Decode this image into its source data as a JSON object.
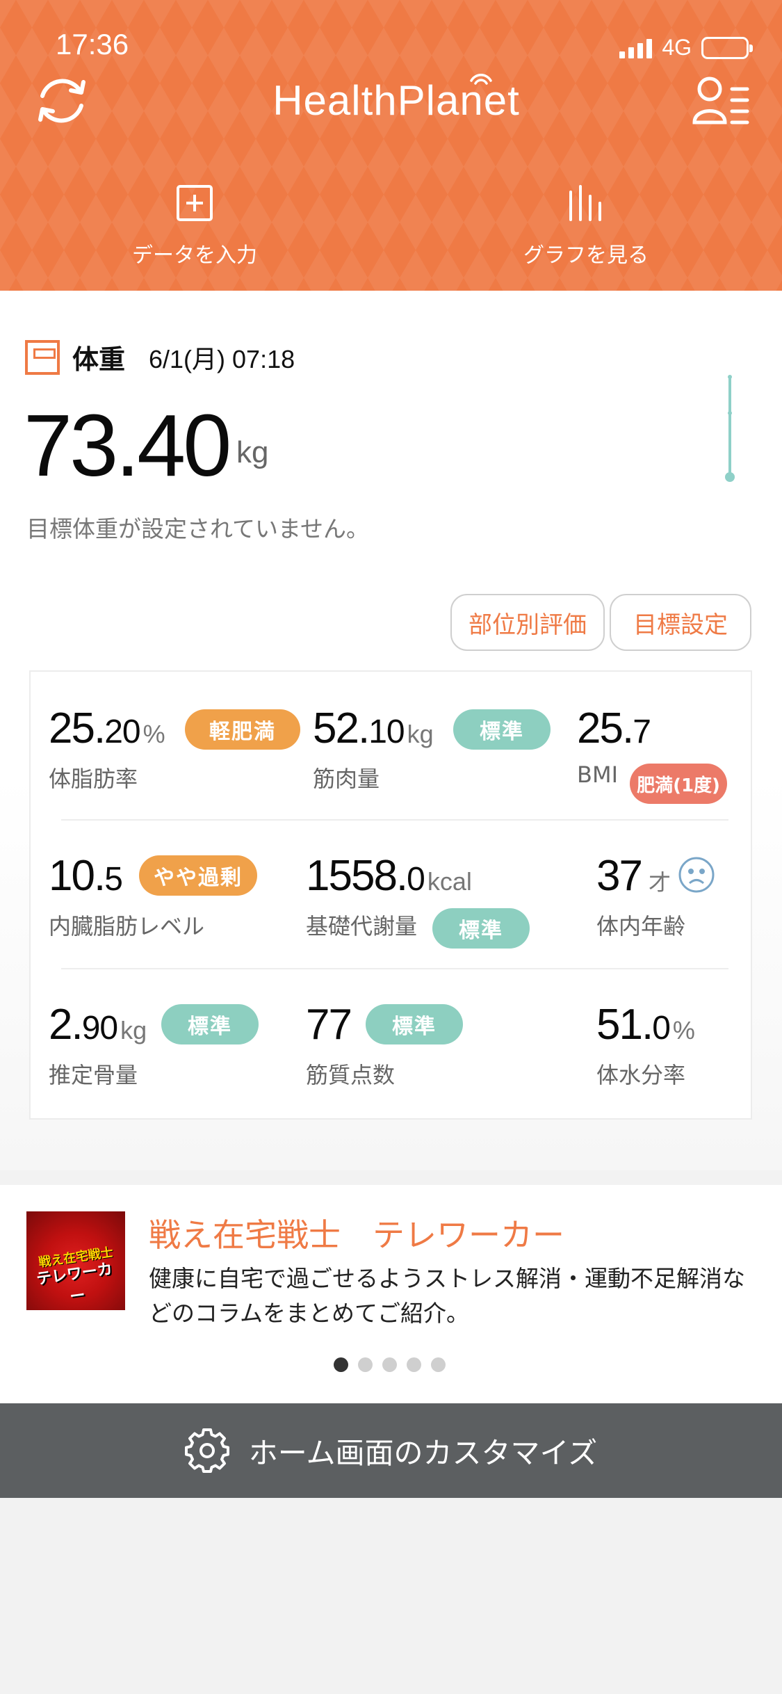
{
  "status_bar": {
    "time": "17:36",
    "network": "4G"
  },
  "header": {
    "logo": "HealthPlanet",
    "actions": [
      {
        "label": "データを入力",
        "icon": "plus-square-icon"
      },
      {
        "label": "グラフを見る",
        "icon": "bar-graph-icon"
      }
    ],
    "accent_color": "#ef7a45"
  },
  "weight": {
    "label": "体重",
    "date": "6/1(月) 07:18",
    "value": "73.40",
    "unit": "kg",
    "note": "目標体重が設定されていません。"
  },
  "buttons": {
    "part_eval": "部位別評価",
    "goal_setting": "目標設定"
  },
  "metrics": {
    "body_fat": {
      "int": "25.",
      "dec": "20",
      "unit": "%",
      "badge": "軽肥満",
      "label": "体脂肪率"
    },
    "muscle": {
      "int": "52.",
      "dec": "10",
      "unit": "kg",
      "badge": "標準",
      "label": "筋肉量"
    },
    "bmi": {
      "int": "25.",
      "dec": "7",
      "badge": "肥満(1度)",
      "label": "BMI"
    },
    "visceral": {
      "int": "10.",
      "dec": "5",
      "badge": "やや過剰",
      "label": "内臓脂肪レベル"
    },
    "bmr": {
      "int": "1558.",
      "dec": "0",
      "unit": "kcal",
      "badge": "標準",
      "label": "基礎代謝量"
    },
    "body_age": {
      "int": "37",
      "unit": "才",
      "label": "体内年齢"
    },
    "bone": {
      "int": "2.",
      "dec": "90",
      "unit": "kg",
      "badge": "標準",
      "label": "推定骨量"
    },
    "muscle_score": {
      "int": "77",
      "badge": "標準",
      "label": "筋質点数"
    },
    "water": {
      "int": "51.",
      "dec": "0",
      "unit": "%",
      "label": "体水分率"
    }
  },
  "banner": {
    "image_text_top": "戦え在宅戦士",
    "image_text_bottom": "テレワーカー",
    "title": "戦え在宅戦士　テレワーカー",
    "description": "健康に自宅で過ごせるようストレス解消・運動不足解消などのコラムをまとめてご紹介。",
    "page_count": 5,
    "active_page": 1
  },
  "footer": {
    "customize_label": "ホーム画面のカスタマイズ"
  }
}
